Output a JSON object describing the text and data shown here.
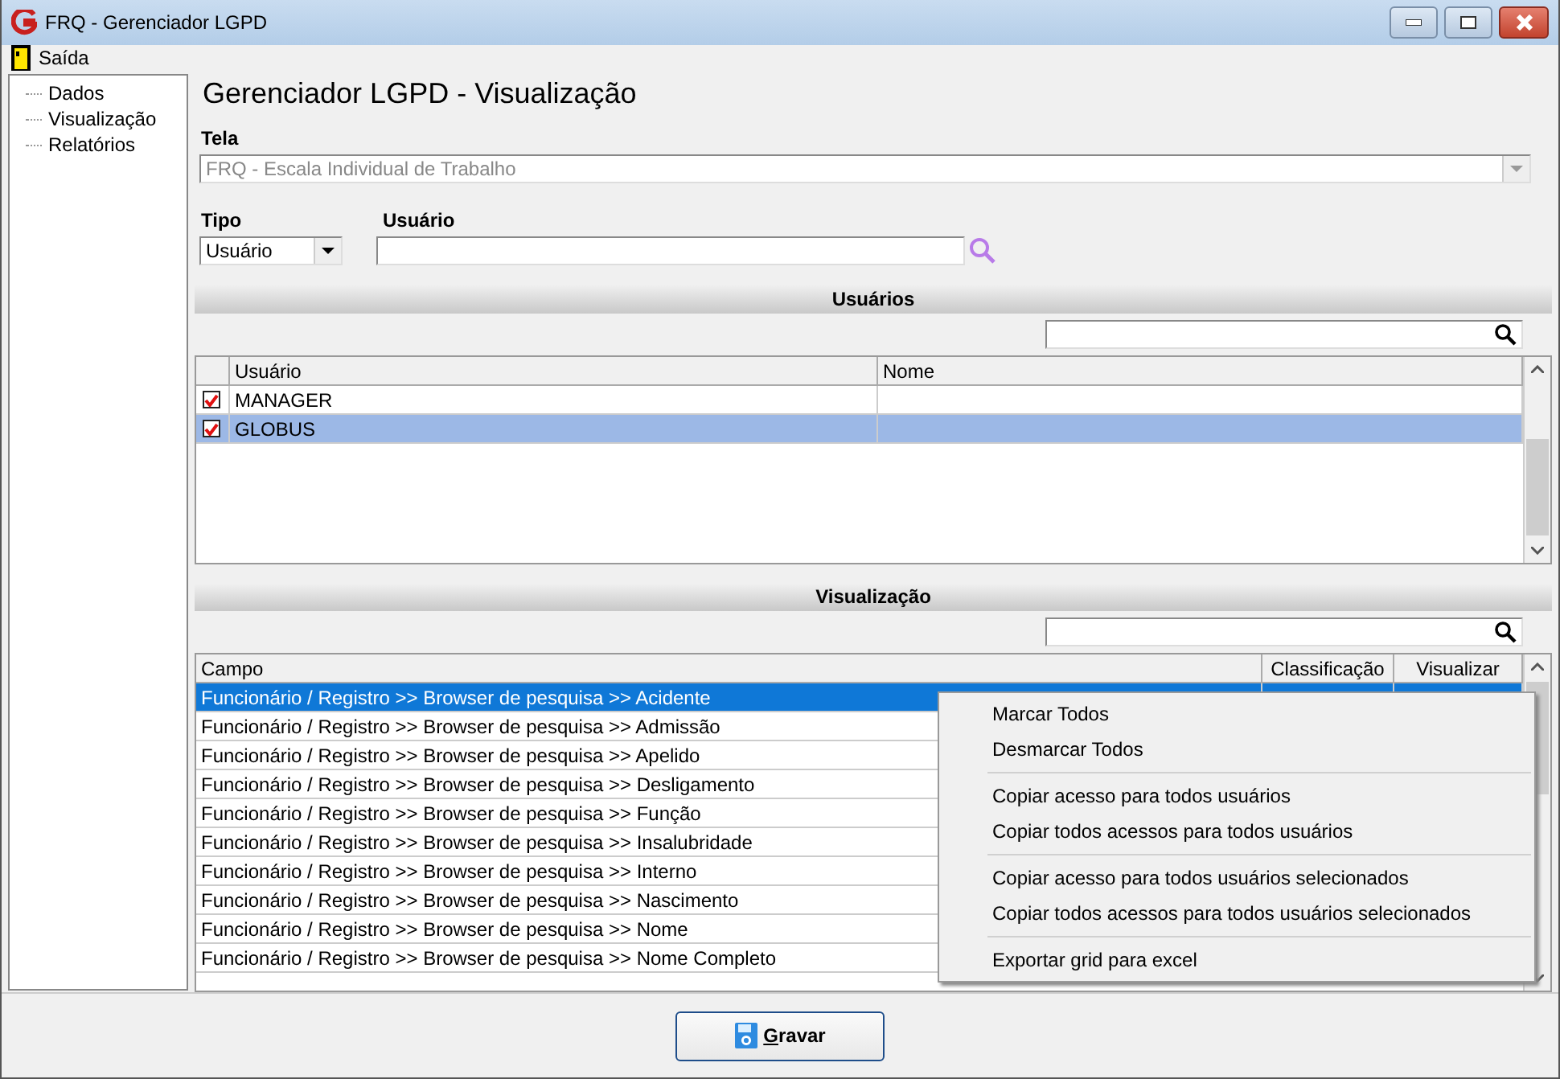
{
  "window": {
    "title": "FRQ - Gerenciador LGPD"
  },
  "menu": [
    {
      "label": "Saída"
    }
  ],
  "tree": [
    {
      "label": "Dados"
    },
    {
      "label": "Visualização"
    },
    {
      "label": "Relatórios"
    }
  ],
  "heading": "Gerenciador LGPD - Visualização",
  "tela": {
    "label": "Tela",
    "value": "FRQ - Escala Individual de Trabalho",
    "disabled": true
  },
  "tipo": {
    "label": "Tipo",
    "value": "Usuário"
  },
  "usuario": {
    "label": "Usuário"
  },
  "users_section": {
    "title": "Usuários",
    "columns": [
      "Usuário",
      "Nome"
    ],
    "rows": [
      {
        "usuario": "MANAGER",
        "checked": true,
        "selected": false
      },
      {
        "usuario": "GLOBUS",
        "checked": true,
        "selected": true
      }
    ]
  },
  "view_section": {
    "title": "Visualização",
    "columns": [
      "Campo",
      "Classificação",
      "Visualizar"
    ],
    "rows": [
      {
        "campo": "Funcionário / Registro >> Browser de pesquisa >> Acidente",
        "selected": true
      },
      {
        "campo": "Funcionário / Registro >> Browser de pesquisa >> Admissão",
        "selected": false
      },
      {
        "campo": "Funcionário / Registro >> Browser de pesquisa >> Apelido",
        "selected": false
      },
      {
        "campo": "Funcionário / Registro >> Browser de pesquisa >> Desligamento",
        "selected": false
      },
      {
        "campo": "Funcionário / Registro >> Browser de pesquisa >> Função",
        "selected": false
      },
      {
        "campo": "Funcionário / Registro >> Browser de pesquisa >> Insalubridade",
        "selected": false
      },
      {
        "campo": "Funcionário / Registro >> Browser de pesquisa >> Interno",
        "selected": false
      },
      {
        "campo": "Funcionário / Registro >> Browser de pesquisa >> Nascimento",
        "selected": false
      },
      {
        "campo": "Funcionário / Registro >> Browser de pesquisa >> Nome",
        "selected": false
      },
      {
        "campo": "Funcionário / Registro >> Browser de pesquisa >> Nome Completo",
        "selected": false
      }
    ]
  },
  "context_menu": [
    {
      "kind": "item",
      "label": "Marcar Todos"
    },
    {
      "kind": "item",
      "label": "Desmarcar Todos"
    },
    {
      "kind": "separator"
    },
    {
      "kind": "item",
      "label": "Copiar acesso para todos usuários"
    },
    {
      "kind": "item",
      "label": "Copiar todos acessos para todos usuários"
    },
    {
      "kind": "separator"
    },
    {
      "kind": "item",
      "label": "Copiar acesso para todos usuários selecionados"
    },
    {
      "kind": "item",
      "label": "Copiar todos acessos para todos usuários selecionados"
    },
    {
      "kind": "separator"
    },
    {
      "kind": "item",
      "label": "Exportar grid para excel"
    }
  ],
  "save_button": {
    "label": "Gravar"
  }
}
